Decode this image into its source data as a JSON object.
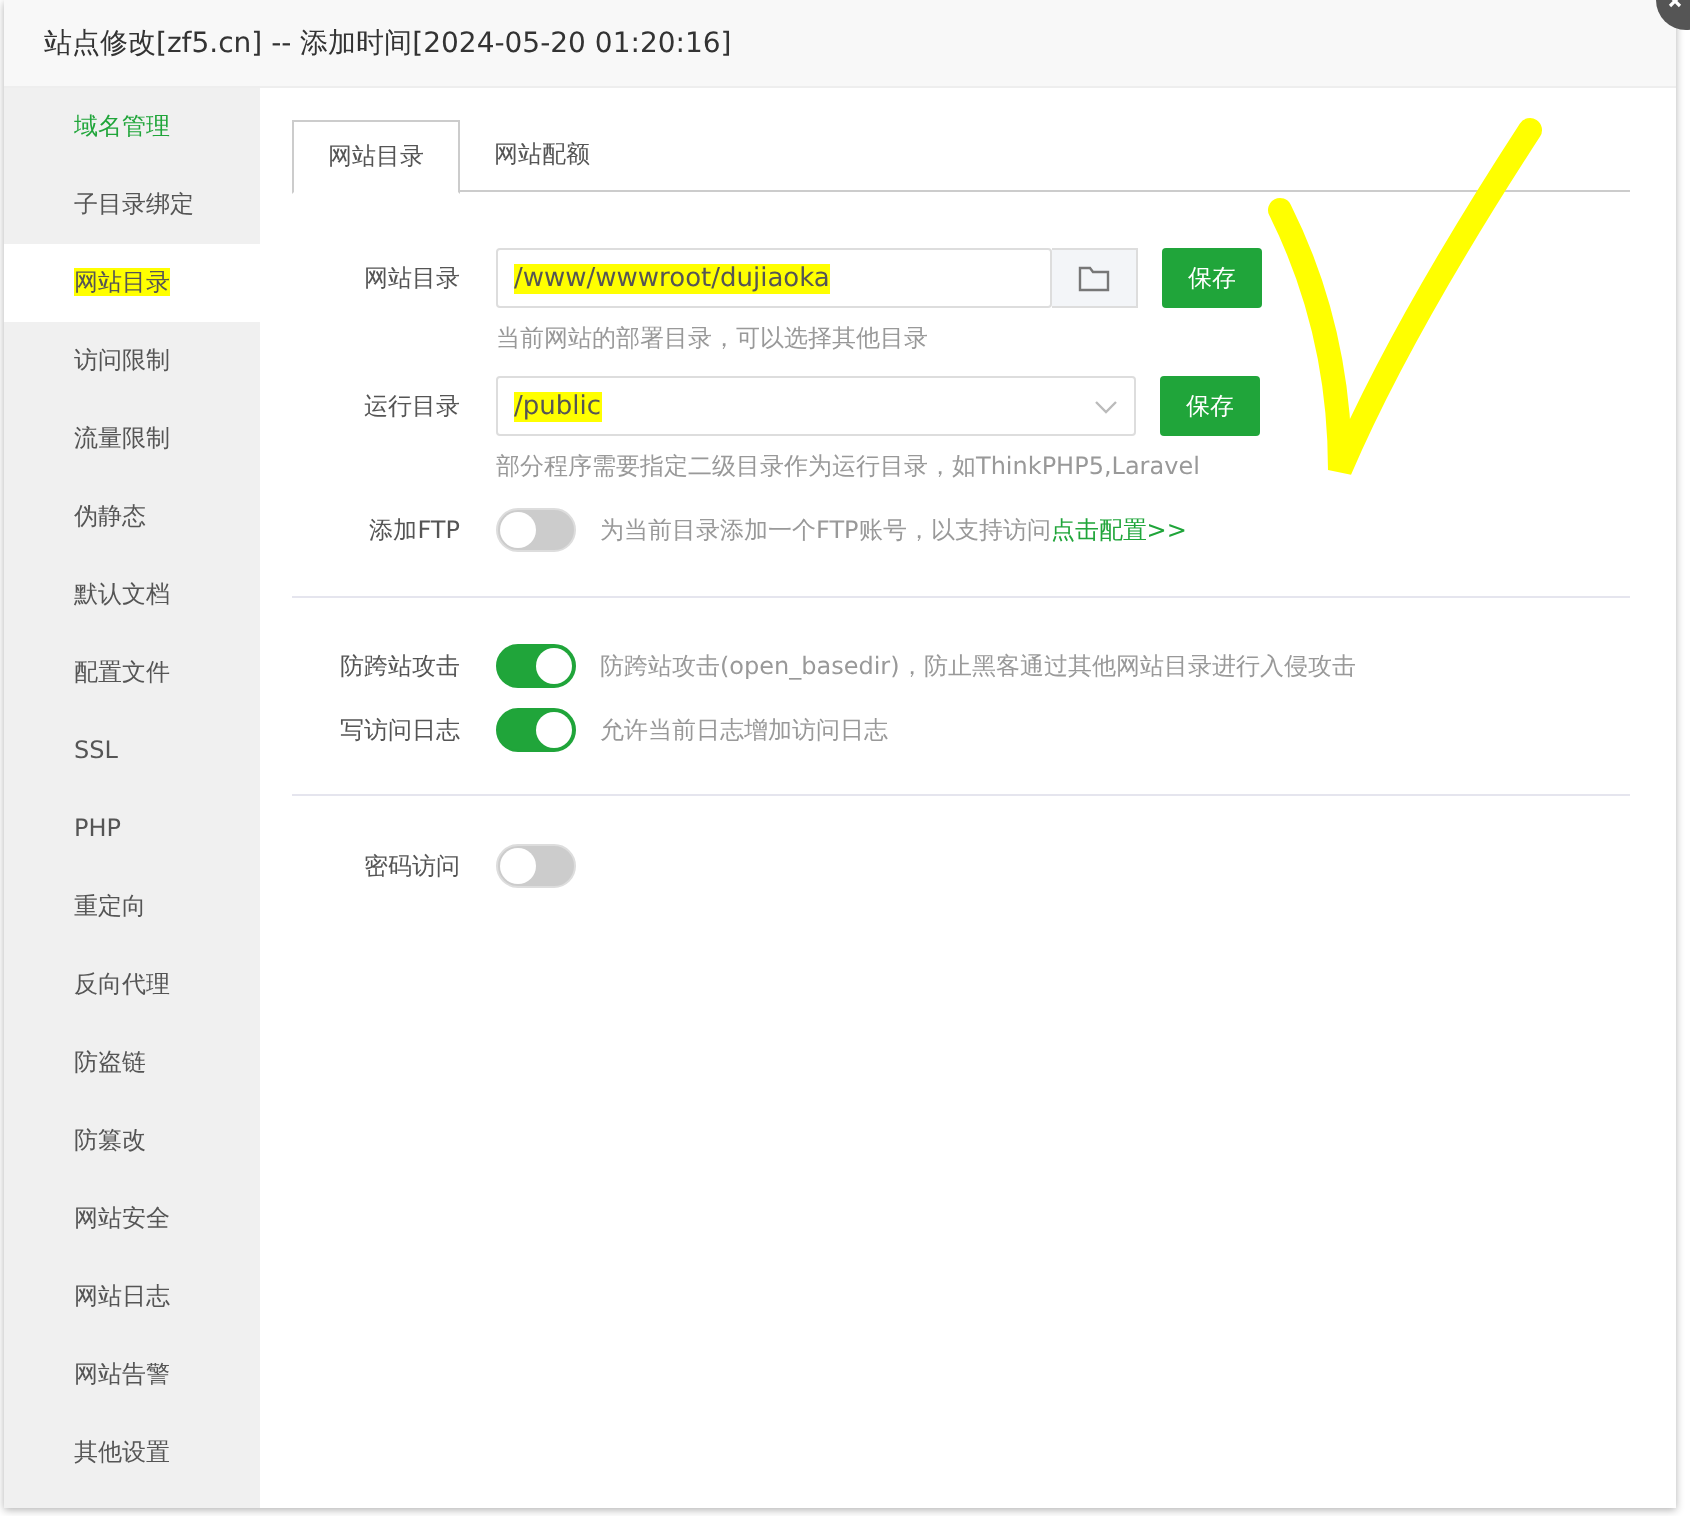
{
  "window": {
    "title": "站点修改[zf5.cn] -- 添加时间[2024-05-20 01:20:16]"
  },
  "sidebar": {
    "items": [
      {
        "label": "域名管理",
        "selected": false,
        "hover": true,
        "marked": false
      },
      {
        "label": "子目录绑定",
        "selected": false,
        "hover": false,
        "marked": false
      },
      {
        "label": "网站目录",
        "selected": true,
        "hover": false,
        "marked": true
      },
      {
        "label": "访问限制",
        "selected": false,
        "hover": false,
        "marked": false
      },
      {
        "label": "流量限制",
        "selected": false,
        "hover": false,
        "marked": false
      },
      {
        "label": "伪静态",
        "selected": false,
        "hover": false,
        "marked": false
      },
      {
        "label": "默认文档",
        "selected": false,
        "hover": false,
        "marked": false
      },
      {
        "label": "配置文件",
        "selected": false,
        "hover": false,
        "marked": false
      },
      {
        "label": "SSL",
        "selected": false,
        "hover": false,
        "marked": false
      },
      {
        "label": "PHP",
        "selected": false,
        "hover": false,
        "marked": false
      },
      {
        "label": "重定向",
        "selected": false,
        "hover": false,
        "marked": false
      },
      {
        "label": "反向代理",
        "selected": false,
        "hover": false,
        "marked": false
      },
      {
        "label": "防盗链",
        "selected": false,
        "hover": false,
        "marked": false
      },
      {
        "label": "防篡改",
        "selected": false,
        "hover": false,
        "marked": false
      },
      {
        "label": "网站安全",
        "selected": false,
        "hover": false,
        "marked": false
      },
      {
        "label": "网站日志",
        "selected": false,
        "hover": false,
        "marked": false
      },
      {
        "label": "网站告警",
        "selected": false,
        "hover": false,
        "marked": false
      },
      {
        "label": "其他设置",
        "selected": false,
        "hover": false,
        "marked": false
      }
    ]
  },
  "tabs": [
    {
      "label": "网站目录",
      "selected": true
    },
    {
      "label": "网站配额",
      "selected": false
    }
  ],
  "site_dir": {
    "label": "网站目录",
    "value": "/www/wwwroot/dujiaoka",
    "marked": true,
    "button": "保存",
    "hint": "当前网站的部署目录，可以选择其他目录"
  },
  "run_dir": {
    "label": "运行目录",
    "value": "/public",
    "marked": true,
    "button": "保存",
    "hint": "部分程序需要指定二级目录作为运行目录，如ThinkPHP5,Laravel"
  },
  "ftp": {
    "label": "添加FTP",
    "on": false,
    "text": "为当前目录添加一个FTP账号，以支持访问",
    "link": "点击配置>>"
  },
  "toggles": [
    {
      "label": "防跨站攻击",
      "on": true,
      "text": "防跨站攻击(open_basedir)，防止黑客通过其他网站目录进行入侵攻击"
    },
    {
      "label": "写访问日志",
      "on": true,
      "text": "允许当前日志增加访问日志"
    }
  ],
  "password": {
    "label": "密码访问",
    "on": false
  }
}
